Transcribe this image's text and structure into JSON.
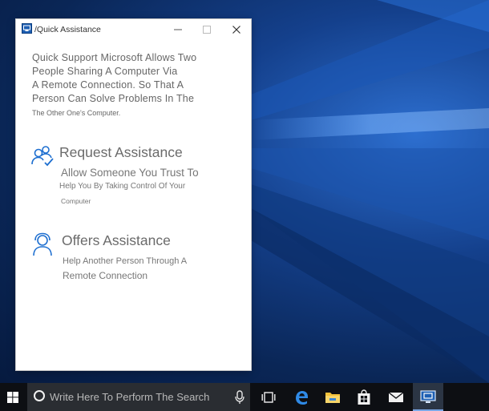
{
  "window": {
    "title": "/Quick Assistance",
    "controls": {
      "minimize_icon": "minimize-icon",
      "maximize_icon": "maximize-icon",
      "close_icon": "close-icon"
    }
  },
  "intro": {
    "line1": "Quick Support Microsoft Allows Two",
    "line2": "People Sharing A Computer Via",
    "line3": "A Remote Connection. So That A",
    "line4": "Person Can Solve Problems In The",
    "line5": "The Other One's Computer."
  },
  "options": [
    {
      "icon": "people-check-icon",
      "title": "Request Assistance",
      "line1": "Allow Someone You Trust To",
      "line2": "Help You By Taking Control Of Your",
      "line3": "Computer"
    },
    {
      "icon": "support-agent-icon",
      "title": "Offers Assistance",
      "line1": "Help Another Person Through A",
      "line2": "Remote Connection"
    }
  ],
  "taskbar": {
    "start_icon": "windows-logo-icon",
    "search_placeholder": "Write Here To Perform The Search",
    "items": [
      "task-view-icon",
      "edge-icon",
      "file-explorer-icon",
      "store-icon",
      "mail-icon",
      "quick-assist-icon"
    ]
  },
  "colors": {
    "accent": "#1e6fd0",
    "taskbar": "#0d0f13",
    "search_box": "#2a2d32"
  }
}
